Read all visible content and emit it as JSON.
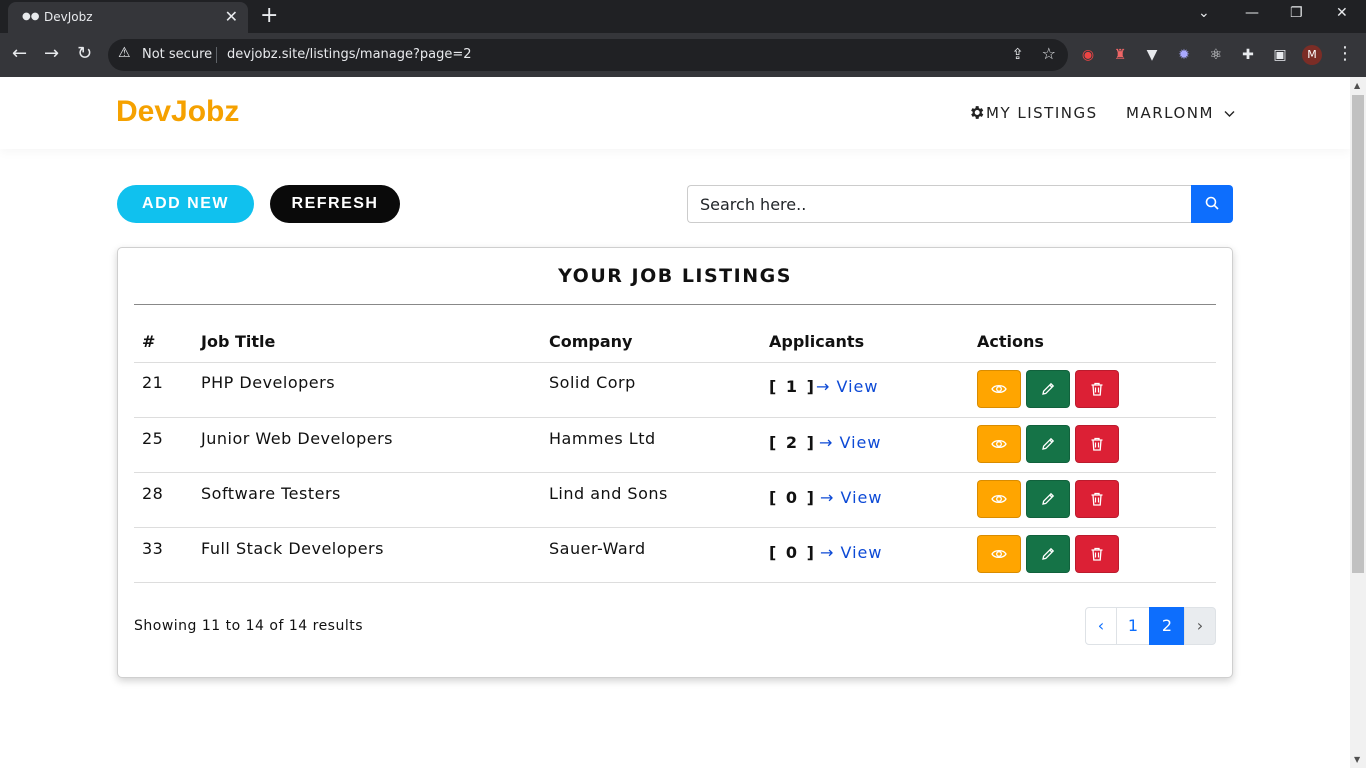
{
  "browser": {
    "tab_title": "DevJobz",
    "url_security": "Not secure",
    "url": "devjobz.site/listings/manage?page=2",
    "profile_initial": "M"
  },
  "header": {
    "logo": "DevJobz",
    "nav_my_listings": "MY LISTINGS",
    "nav_user": "MARLONM"
  },
  "toolbar": {
    "add_new_label": "ADD NEW",
    "refresh_label": "REFRESH",
    "search_placeholder": "Search here.."
  },
  "card": {
    "title": "YOUR JOB LISTINGS",
    "columns": [
      "#",
      "Job Title",
      "Company",
      "Applicants",
      "Actions"
    ],
    "rows": [
      {
        "id": "21",
        "title": "PHP Developers",
        "company": "Solid Corp",
        "applicants": "[ 1 ]",
        "view": "View"
      },
      {
        "id": "25",
        "title": "Junior Web Developers",
        "company": "Hammes Ltd",
        "applicants": "[ 2 ]",
        "view": "View"
      },
      {
        "id": "28",
        "title": "Software Testers",
        "company": "Lind and Sons",
        "applicants": "[ 0 ]",
        "view": "View"
      },
      {
        "id": "33",
        "title": "Full Stack Developers",
        "company": "Sauer-Ward",
        "applicants": "[ 0 ]",
        "view": "View"
      }
    ],
    "summary": "Showing 11 to 14 of 14 results",
    "pagination": {
      "prev": "‹",
      "pages": [
        "1",
        "2"
      ],
      "current": "2",
      "next": "›"
    }
  },
  "colors": {
    "brand": "#f5a100",
    "add_new": "#10c1ee",
    "primary": "#0d6efd",
    "view_action": "#ffa500",
    "edit_action": "#157347",
    "delete_action": "#dc2035"
  }
}
